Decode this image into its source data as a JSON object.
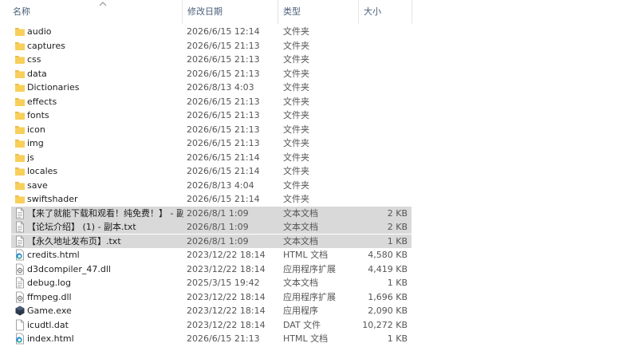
{
  "columns": {
    "name": "名称",
    "date": "修改日期",
    "type": "类型",
    "size": "大小"
  },
  "files": [
    {
      "name": "audio",
      "date": "2026/6/15 12:14",
      "type": "文件夹",
      "size": "",
      "icon": "folder-icon",
      "selected": false
    },
    {
      "name": "captures",
      "date": "2026/6/15 21:13",
      "type": "文件夹",
      "size": "",
      "icon": "folder-icon",
      "selected": false
    },
    {
      "name": "css",
      "date": "2026/6/15 21:13",
      "type": "文件夹",
      "size": "",
      "icon": "folder-icon",
      "selected": false
    },
    {
      "name": "data",
      "date": "2026/6/15 21:13",
      "type": "文件夹",
      "size": "",
      "icon": "folder-icon",
      "selected": false
    },
    {
      "name": "Dictionaries",
      "date": "2026/8/13 4:03",
      "type": "文件夹",
      "size": "",
      "icon": "folder-icon",
      "selected": false
    },
    {
      "name": "effects",
      "date": "2026/6/15 21:13",
      "type": "文件夹",
      "size": "",
      "icon": "folder-icon",
      "selected": false
    },
    {
      "name": "fonts",
      "date": "2026/6/15 21:13",
      "type": "文件夹",
      "size": "",
      "icon": "folder-icon",
      "selected": false
    },
    {
      "name": "icon",
      "date": "2026/6/15 21:13",
      "type": "文件夹",
      "size": "",
      "icon": "folder-icon",
      "selected": false
    },
    {
      "name": "img",
      "date": "2026/6/15 21:13",
      "type": "文件夹",
      "size": "",
      "icon": "folder-icon",
      "selected": false
    },
    {
      "name": "js",
      "date": "2026/6/15 21:14",
      "type": "文件夹",
      "size": "",
      "icon": "folder-icon",
      "selected": false
    },
    {
      "name": "locales",
      "date": "2026/6/15 21:14",
      "type": "文件夹",
      "size": "",
      "icon": "folder-icon",
      "selected": false
    },
    {
      "name": "save",
      "date": "2026/8/13 4:04",
      "type": "文件夹",
      "size": "",
      "icon": "folder-icon",
      "selected": false
    },
    {
      "name": "swiftshader",
      "date": "2026/6/15 21:14",
      "type": "文件夹",
      "size": "",
      "icon": "folder-icon",
      "selected": false
    },
    {
      "name": "【来了就能下载和观看！纯免费！】 - 副...",
      "date": "2026/8/1 1:09",
      "type": "文本文档",
      "size": "2 KB",
      "icon": "text-file-icon",
      "selected": true
    },
    {
      "name": "【论坛介绍】 (1) - 副本.txt",
      "date": "2026/8/1 1:09",
      "type": "文本文档",
      "size": "2 KB",
      "icon": "text-file-icon",
      "selected": true
    },
    {
      "name": "【永久地址发布页】.txt",
      "date": "2026/8/1 1:09",
      "type": "文本文档",
      "size": "1 KB",
      "icon": "text-file-icon",
      "selected": true
    },
    {
      "name": "credits.html",
      "date": "2023/12/22 18:14",
      "type": "HTML 文档",
      "size": "4,580 KB",
      "icon": "edge-html-icon",
      "selected": false
    },
    {
      "name": "d3dcompiler_47.dll",
      "date": "2023/12/22 18:14",
      "type": "应用程序扩展",
      "size": "4,419 KB",
      "icon": "dll-file-icon",
      "selected": false
    },
    {
      "name": "debug.log",
      "date": "2025/3/15 19:42",
      "type": "文本文档",
      "size": "1 KB",
      "icon": "text-file-icon",
      "selected": false
    },
    {
      "name": "ffmpeg.dll",
      "date": "2023/12/22 18:14",
      "type": "应用程序扩展",
      "size": "1,696 KB",
      "icon": "dll-file-icon",
      "selected": false
    },
    {
      "name": "Game.exe",
      "date": "2023/12/22 18:14",
      "type": "应用程序",
      "size": "2,090 KB",
      "icon": "game-exe-icon",
      "selected": false
    },
    {
      "name": "icudtl.dat",
      "date": "2023/12/22 18:14",
      "type": "DAT 文件",
      "size": "10,272 KB",
      "icon": "blank-file-icon",
      "selected": false
    },
    {
      "name": "index.html",
      "date": "2026/6/15 21:13",
      "type": "HTML 文档",
      "size": "1 KB",
      "icon": "edge-html-icon",
      "selected": false
    }
  ]
}
